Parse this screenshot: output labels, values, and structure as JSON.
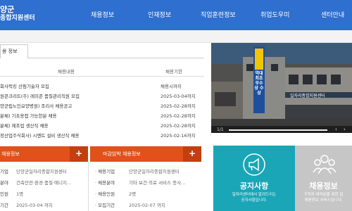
{
  "header": {
    "logo_line1": "양군",
    "logo_line2": "종합지원센터",
    "nav": [
      "채용정보",
      "인재정보",
      "직업훈련정보",
      "취업도우미",
      "센터안내"
    ]
  },
  "notice": {
    "tab_label": "용 정보",
    "col_title": "채용내용",
    "col_date": "채용기한",
    "rows": [
      {
        "title": "회사럭킹 산림기술자 모집",
        "date": "채용시까지"
      },
      {
        "title": "원콘크리트(주) 레미콘 품질관리직원 모집",
        "date": "2025-03-04까지"
      },
      {
        "title": "양군립노인요양병원) 조리사 채용공고",
        "date": "2025-02-28까지"
      },
      {
        "title": "분체) 기초용접 가능한분 채용",
        "date": "2025-02-28까지"
      },
      {
        "title": "분체) 제조업 생산직 채용",
        "date": "2025-02-28까지"
      },
      {
        "title": "정산업주식회사) 시멘트 설비 생산직 채용",
        "date": "2025-02-16까지"
      }
    ]
  },
  "slider": {
    "banner_text": "역대 최초 우수상 수상",
    "sign_text": "일자리종합지원센터",
    "counter": "1/1",
    "progress": 1.0,
    "prev": "‹",
    "next": "›"
  },
  "jobs_box": {
    "title": "채용정보",
    "plus": "+",
    "items": [
      {
        "key": "기업",
        "value": "단양군일자리종합지원센터"
      },
      {
        "key": "분야",
        "value": "건축안전·환경·품질·에너지..."
      },
      {
        "key": "인원",
        "value": "1명"
      },
      {
        "key": "기간",
        "value": "2025-03-04 까지"
      }
    ]
  },
  "deadline_box": {
    "title": "마감임박 채용정보",
    "plus": "+",
    "items": [
      {
        "key": "· 채용기업",
        "value": "단양군일자리종합지원센터"
      },
      {
        "key": "· 채용분야",
        "value": "기타 보건·의료 서비스 종사..."
      },
      {
        "key": "· 채용인원",
        "value": "2명"
      },
      {
        "key": "· 모집기간",
        "value": "2025-02-07 까지"
      }
    ]
  },
  "tiles": {
    "notice": {
      "title": "공지사항",
      "desc1": "일자리센터에서 알려드리는",
      "desc2": "공지사항입니다."
    },
    "jobs": {
      "title": "채용정보",
      "desc1": "구직자 여러분을 위한 일",
      "desc2": "채용정보 서비스입니다."
    }
  },
  "colors": {
    "header": "#2e6fcf",
    "accent": "#e2501c",
    "teal": "#1aa6b7"
  }
}
